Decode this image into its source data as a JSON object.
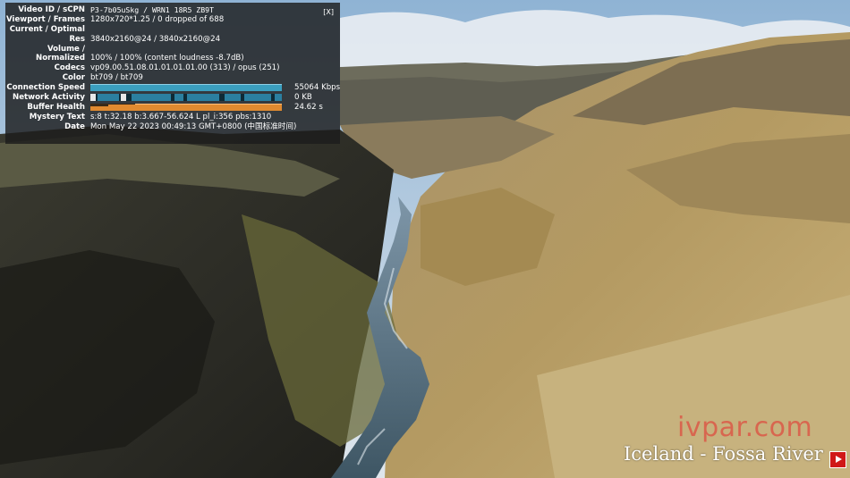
{
  "stats": {
    "close": "[X]",
    "rows": [
      {
        "label": "Video ID / sCPN",
        "value": "P3-7b05uSkg  /  WRN1 18R5 ZB9T"
      },
      {
        "label": "Viewport / Frames",
        "value": "1280x720*1.25 / 0 dropped of 688"
      },
      {
        "label": "Current / Optimal",
        "value": ""
      },
      {
        "label": "Res",
        "value": "3840x2160@24 / 3840x2160@24"
      },
      {
        "label": "Volume /",
        "value": ""
      },
      {
        "label": "Normalized",
        "value": "100% / 100% (content loudness -8.7dB)"
      },
      {
        "label": "Codecs",
        "value": "vp09.00.51.08.01.01.01.01.00 (313) / opus (251)"
      },
      {
        "label": "Color",
        "value": "bt709 / bt709"
      },
      {
        "label": "Connection Speed",
        "value": "55064 Kbps"
      },
      {
        "label": "Network Activity",
        "value": "0 KB"
      },
      {
        "label": "Buffer Health",
        "value": "24.62 s"
      },
      {
        "label": "Mystery Text",
        "value": "s:8 t:32.18 b:3.667-56.624 L pl_i:356 pbs:1310"
      },
      {
        "label": "Date",
        "value": "Mon May 22 2023 00:49:13 GMT+0800 (中国标准时间)"
      }
    ]
  },
  "watermark": "ivpar.com",
  "caption": "Iceland - Fossa River",
  "colors": {
    "graph_speed": "#3b9fbf",
    "graph_network": "#2b7fa0",
    "graph_buffer": "#e08a30",
    "watermark": "#e62828",
    "yt_red": "#d01818"
  }
}
